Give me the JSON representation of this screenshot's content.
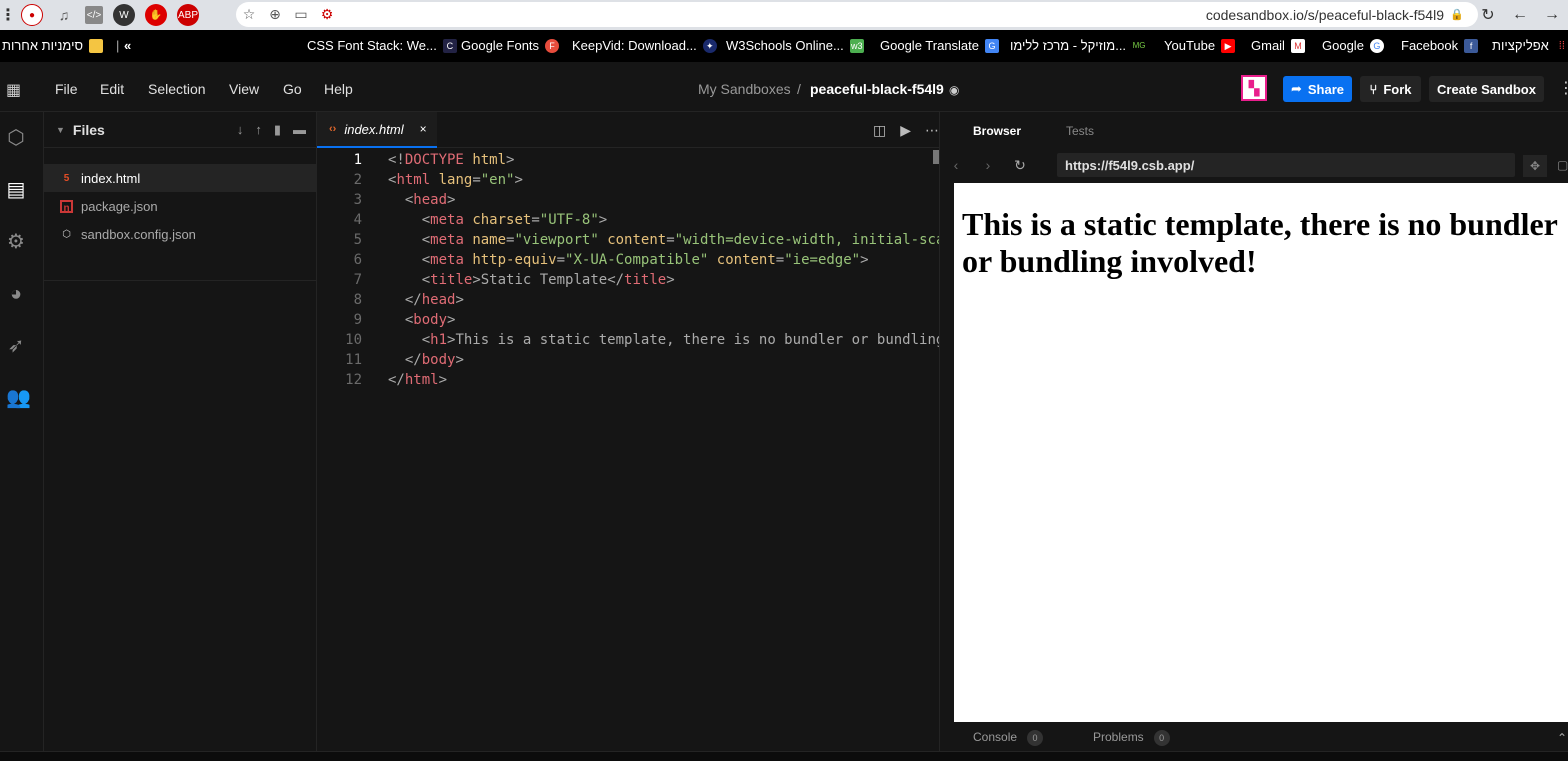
{
  "chrome": {
    "url": "codesandbox.io/s/peaceful-black-f54l9"
  },
  "bookmarks": [
    {
      "label": "סימניות אחרות",
      "icon": "folder-icon"
    },
    {
      "label": "CSS Font Stack: We...",
      "icon": "cssfontstack-icon"
    },
    {
      "label": "Google Fonts",
      "icon": "googlefonts-icon"
    },
    {
      "label": "KeepVid: Download...",
      "icon": "keepvid-icon"
    },
    {
      "label": "W3Schools Online...",
      "icon": "w3schools-icon"
    },
    {
      "label": "Google Translate",
      "icon": "translate-icon"
    },
    {
      "label": "מוזיקל - מרכז ללימו...",
      "icon": "music-icon"
    },
    {
      "label": "YouTube",
      "icon": "youtube-icon"
    },
    {
      "label": "Gmail",
      "icon": "gmail-icon"
    },
    {
      "label": "Google",
      "icon": "google-icon"
    },
    {
      "label": "Facebook",
      "icon": "facebook-icon"
    },
    {
      "label": "אפליקציות",
      "icon": "apps-icon"
    }
  ],
  "menu": [
    "File",
    "Edit",
    "Selection",
    "View",
    "Go",
    "Help"
  ],
  "breadcrumb": {
    "parent": "My Sandboxes",
    "separator": "/",
    "name": "peaceful-black-f54l9"
  },
  "header_buttons": {
    "share": "Share",
    "fork": "Fork",
    "create": "Create Sandbox"
  },
  "files_panel": {
    "title": "Files",
    "files": [
      {
        "name": "index.html",
        "active": true
      },
      {
        "name": "package.json",
        "active": false
      },
      {
        "name": "sandbox.config.json",
        "active": false
      }
    ]
  },
  "editor": {
    "tab": "index.html",
    "close": "×",
    "lines": [
      {
        "n": "1"
      },
      {
        "n": "2"
      },
      {
        "n": "3"
      },
      {
        "n": "4"
      },
      {
        "n": "5"
      },
      {
        "n": "6"
      },
      {
        "n": "7"
      },
      {
        "n": "8"
      },
      {
        "n": "9"
      },
      {
        "n": "10"
      },
      {
        "n": "11"
      },
      {
        "n": "12"
      }
    ],
    "code": {
      "l1_doctype": "DOCTYPE",
      "l1_html": "html",
      "l2_lang_val": "\"en\"",
      "l4_charset_val": "\"UTF-8\"",
      "l5_name_val": "\"viewport\"",
      "l5_content_val": "\"width=device-width, initial-scale=",
      "l6_http_val": "\"X-UA-Compatible\"",
      "l6_content_val": "\"ie=edge\"",
      "l7_title_text": "Static Template",
      "l10_h1_text": "This is a static template, there is no bundler or bundling in"
    }
  },
  "preview": {
    "tabs": [
      "Browser",
      "Tests"
    ],
    "url": "https://f54l9.csb.app/",
    "heading": "This is a static template, there is no bundler or bundling involved!",
    "console_label": "Console",
    "console_count": "0",
    "problems_label": "Problems",
    "problems_count": "0"
  }
}
